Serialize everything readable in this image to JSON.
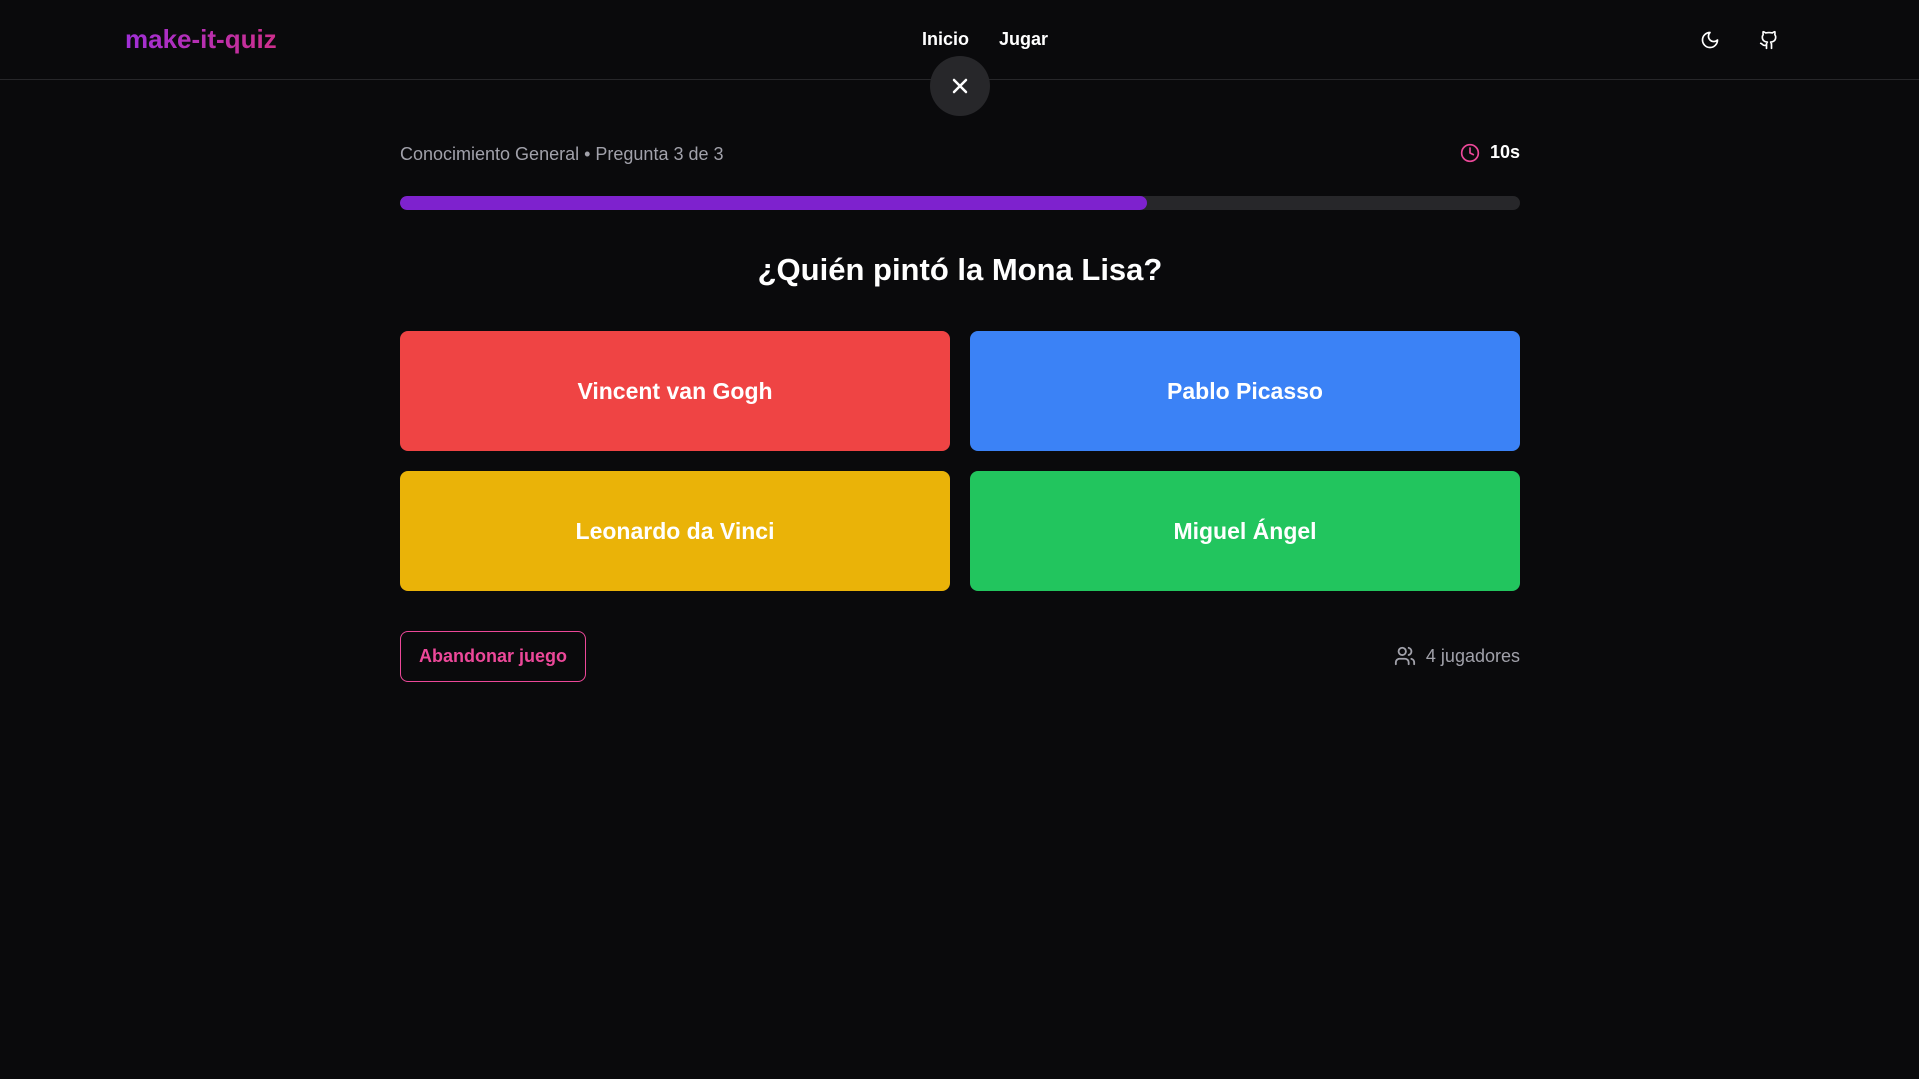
{
  "app": {
    "logo": "make-it-quiz",
    "nav": [
      "Inicio",
      "Jugar"
    ],
    "icons": [
      "moon-icon",
      "github-icon",
      "close-icon"
    ]
  },
  "quiz": {
    "meta": "Conocimiento General • Pregunta 3 de 3",
    "timer": "10s",
    "progress_fraction": 0.667,
    "question": "¿Quién pintó la Mona Lisa?",
    "answers": [
      {
        "label": "Vincent van Gogh",
        "color": "#ef4444"
      },
      {
        "label": "Pablo Picasso",
        "color": "#3b82f6"
      },
      {
        "label": "Leonardo da Vinci",
        "color": "#eab308"
      },
      {
        "label": "Miguel Ángel",
        "color": "#22c55e"
      }
    ],
    "leave_label": "Abandonar juego",
    "players": "4 jugadores"
  },
  "colors": {
    "background": "#0a0a0c",
    "progress": "#7e22ce",
    "accent_pink": "#ec4899"
  }
}
